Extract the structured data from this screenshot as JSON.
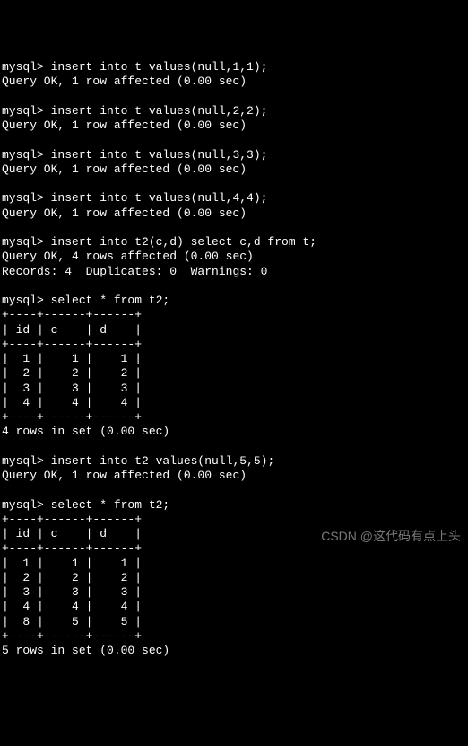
{
  "prompt": "mysql> ",
  "blocks": [
    {
      "cmd": "insert into t values(null,1,1);",
      "res": [
        "Query OK, 1 row affected (0.00 sec)"
      ]
    },
    {
      "cmd": "insert into t values(null,2,2);",
      "res": [
        "Query OK, 1 row affected (0.00 sec)"
      ]
    },
    {
      "cmd": "insert into t values(null,3,3);",
      "res": [
        "Query OK, 1 row affected (0.00 sec)"
      ]
    },
    {
      "cmd": "insert into t values(null,4,4);",
      "res": [
        "Query OK, 1 row affected (0.00 sec)"
      ]
    },
    {
      "cmd": "insert into t2(c,d) select c,d from t;",
      "res": [
        "Query OK, 4 rows affected (0.00 sec)",
        "Records: 4  Duplicates: 0  Warnings: 0"
      ]
    },
    {
      "cmd": "select * from t2;",
      "table": {
        "cols": [
          "id",
          "c",
          "d"
        ],
        "rows": [
          [
            1,
            1,
            1
          ],
          [
            2,
            2,
            2
          ],
          [
            3,
            3,
            3
          ],
          [
            4,
            4,
            4
          ]
        ]
      },
      "footer": "4 rows in set (0.00 sec)"
    },
    {
      "cmd": "insert into t2 values(null,5,5);",
      "res": [
        "Query OK, 1 row affected (0.00 sec)"
      ]
    },
    {
      "cmd": "select * from t2;",
      "table": {
        "cols": [
          "id",
          "c",
          "d"
        ],
        "rows": [
          [
            1,
            1,
            1
          ],
          [
            2,
            2,
            2
          ],
          [
            3,
            3,
            3
          ],
          [
            4,
            4,
            4
          ],
          [
            8,
            5,
            5
          ]
        ]
      },
      "footer": "5 rows in set (0.00 sec)"
    }
  ],
  "watermark": "CSDN @这代码有点上头"
}
